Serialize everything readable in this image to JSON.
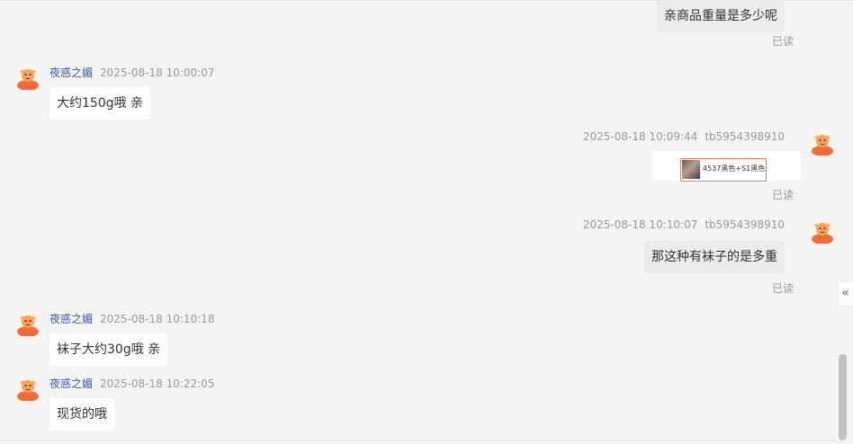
{
  "messages": [
    {
      "direction": "out",
      "text": "亲商品重量是多少呢",
      "read": "已读"
    },
    {
      "direction": "in",
      "nick": "夜惑之媚",
      "time": "2025-08-18 10:00:07",
      "text": "大约150g哦 亲"
    },
    {
      "direction": "out",
      "time": "2025-08-18 10:09:44",
      "user": "tb5954398910",
      "product": {
        "name": "4537黑色+S1黑色"
      },
      "read": "已读"
    },
    {
      "direction": "out",
      "time": "2025-08-18 10:10:07",
      "user": "tb5954398910",
      "text": "那这种有袜子的是多重",
      "read": "已读"
    },
    {
      "direction": "in",
      "nick": "夜惑之媚",
      "time": "2025-08-18 10:10:18",
      "text": "袜子大约30g哦 亲"
    },
    {
      "direction": "in",
      "nick": "夜惑之媚",
      "time": "2025-08-18 10:22:05",
      "text": "现货的哦"
    }
  ],
  "collapse_icon": "«",
  "colors": {
    "background": "#f4f4f4",
    "nick": "#3b5aa8",
    "product_border": "#e2805d"
  }
}
